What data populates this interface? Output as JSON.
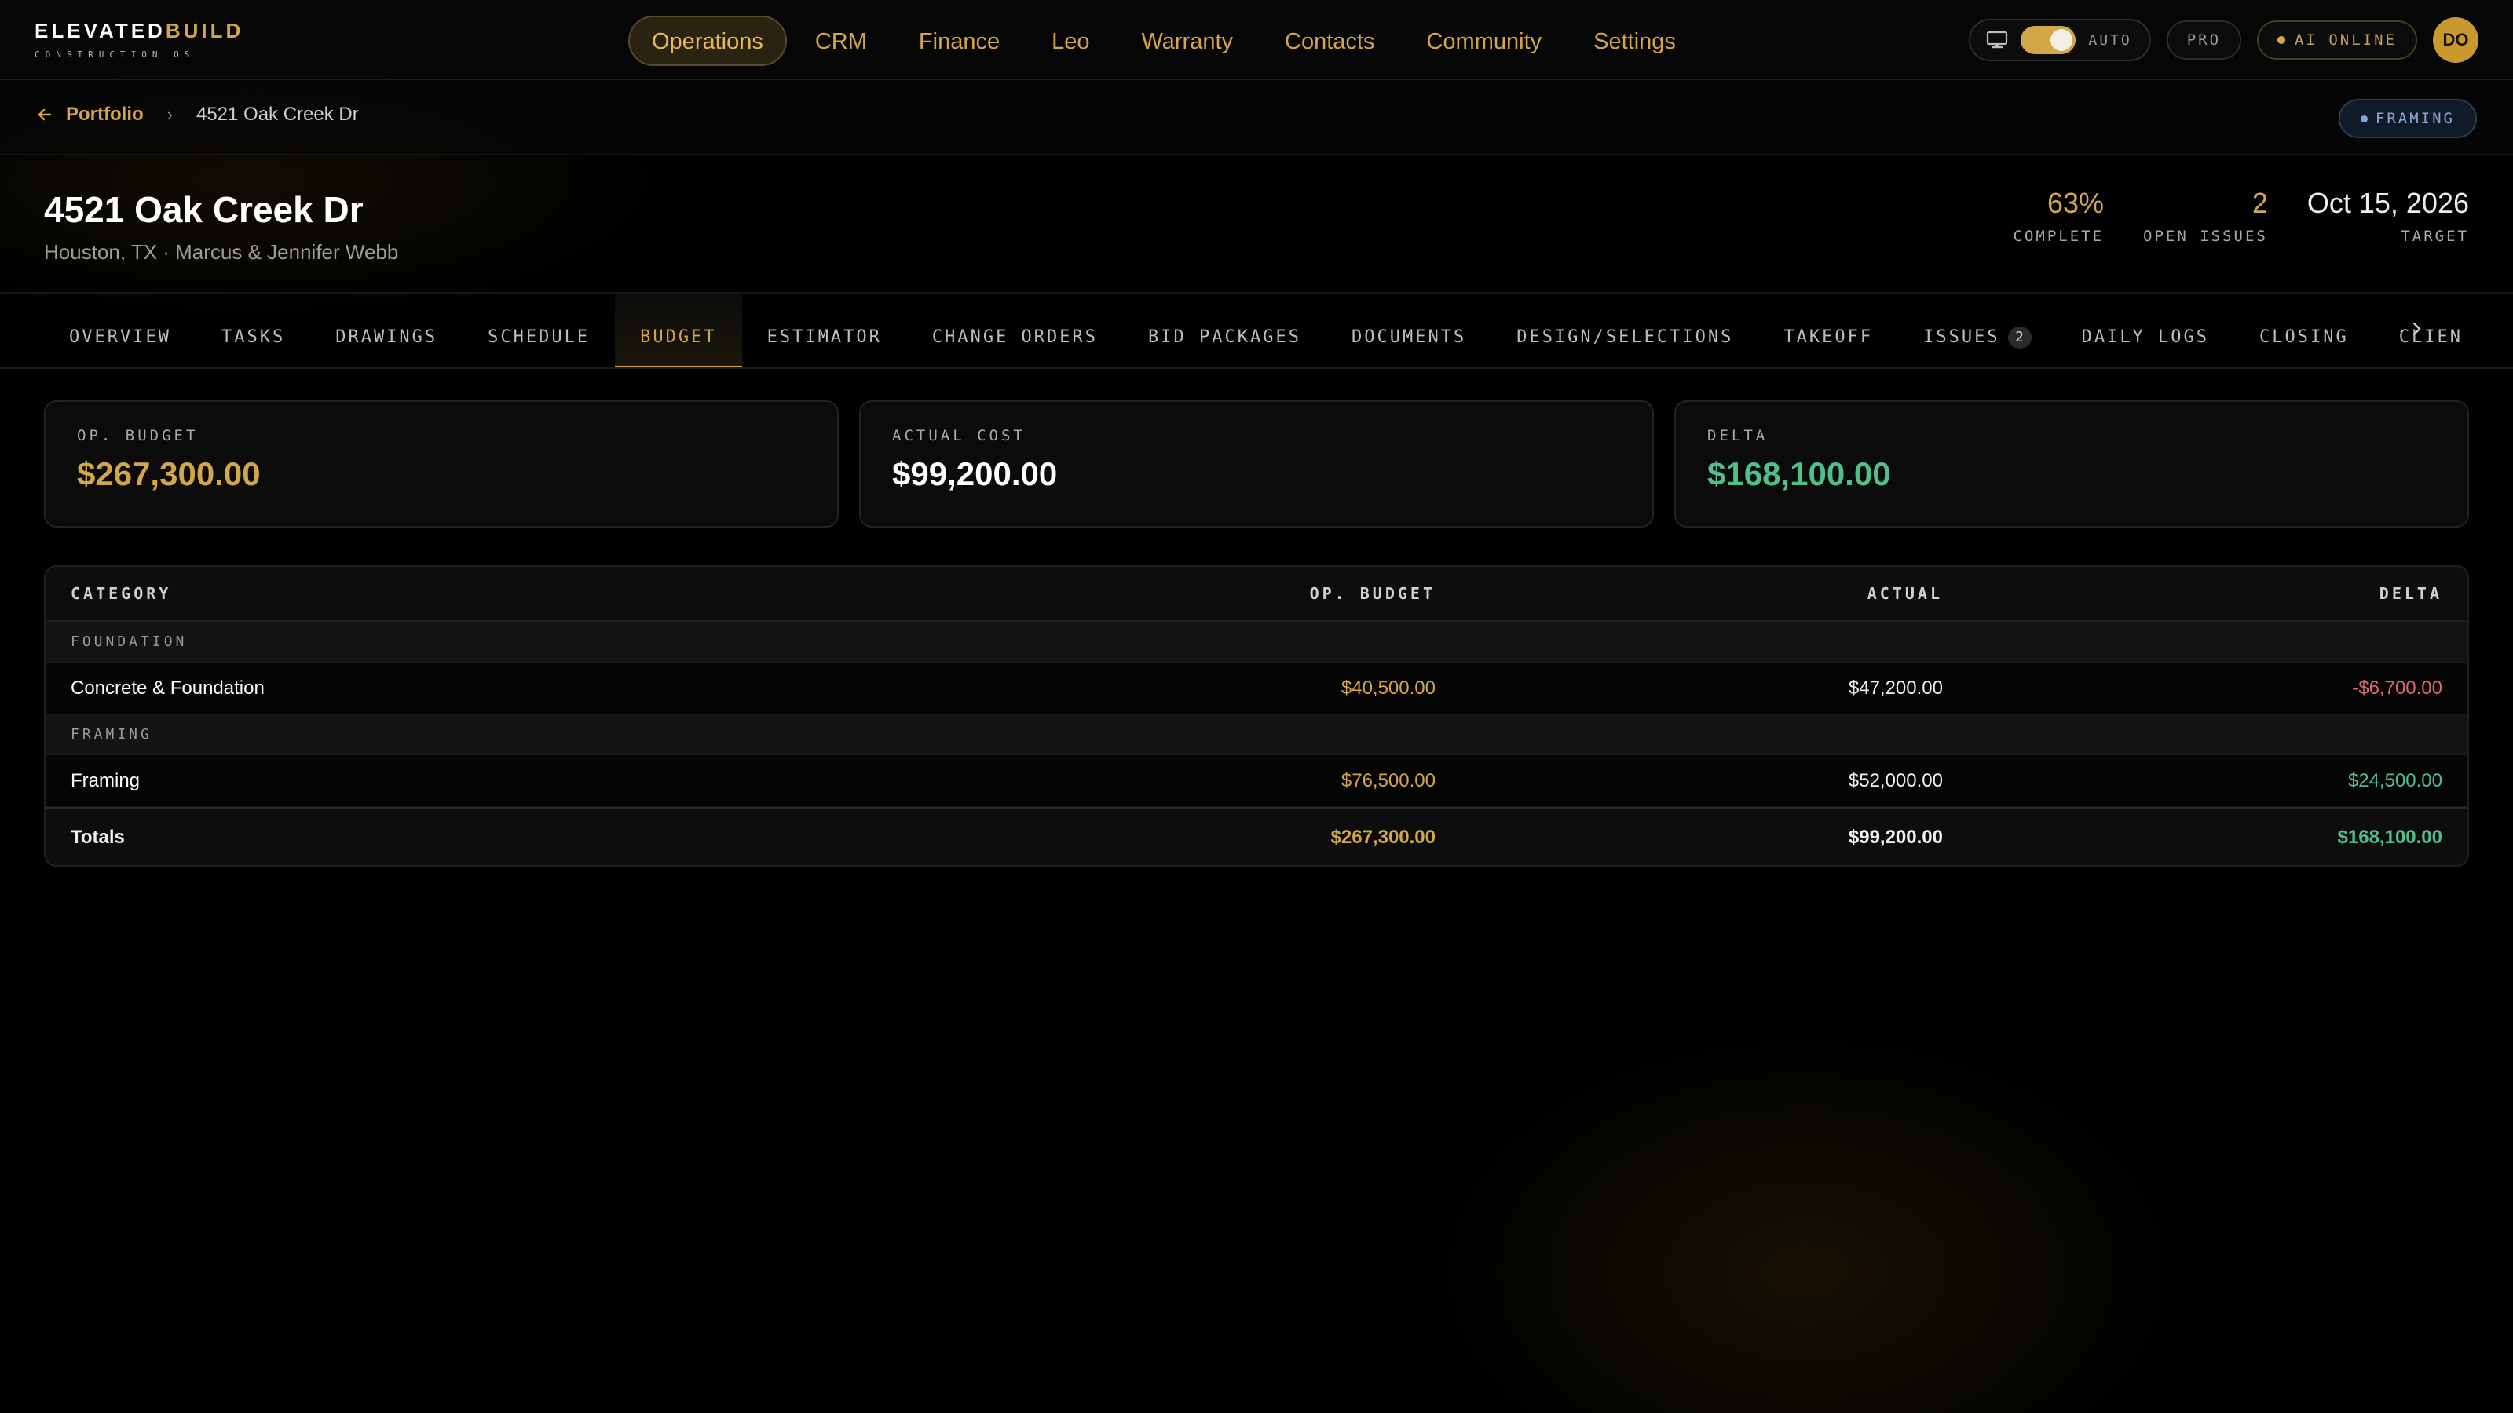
{
  "brand": {
    "name_a": "ELEVATED",
    "name_b": "BUILD",
    "tagline": "CONSTRUCTION OS",
    "accent_color": "#d4a64a"
  },
  "nav": {
    "items": [
      "Operations",
      "CRM",
      "Finance",
      "Leo",
      "Warranty",
      "Contacts",
      "Community",
      "Settings"
    ],
    "active": "Operations"
  },
  "controls": {
    "theme_icon": "monitor-icon",
    "mode_label": "AUTO",
    "plan_label": "PRO",
    "ai_status": "AI ONLINE",
    "user_initials": "DO"
  },
  "breadcrumb": {
    "parent": "Portfolio",
    "separator": "›",
    "current": "4521 Oak Creek Dr"
  },
  "phase_badge": "FRAMING",
  "project": {
    "title": "4521 Oak Creek Dr",
    "subtitle": "Houston, TX · Marcus & Jennifer Webb",
    "stats": [
      {
        "value": "63%",
        "label": "COMPLETE"
      },
      {
        "value": "2",
        "label": "OPEN ISSUES"
      },
      {
        "value": "Oct 15, 2026",
        "label": "TARGET"
      }
    ]
  },
  "tabs": [
    {
      "label": "OVERVIEW"
    },
    {
      "label": "TASKS"
    },
    {
      "label": "DRAWINGS"
    },
    {
      "label": "SCHEDULE"
    },
    {
      "label": "BUDGET",
      "active": true
    },
    {
      "label": "ESTIMATOR"
    },
    {
      "label": "CHANGE ORDERS"
    },
    {
      "label": "BID PACKAGES"
    },
    {
      "label": "DOCUMENTS"
    },
    {
      "label": "DESIGN/SELECTIONS"
    },
    {
      "label": "TAKEOFF"
    },
    {
      "label": "ISSUES",
      "badge": "2"
    },
    {
      "label": "DAILY LOGS"
    },
    {
      "label": "CLOSING"
    },
    {
      "label": "CLIEN"
    }
  ],
  "summary": [
    {
      "label": "OP. BUDGET",
      "value": "$267,300.00",
      "tone": "gold"
    },
    {
      "label": "ACTUAL COST",
      "value": "$99,200.00",
      "tone": "white"
    },
    {
      "label": "DELTA",
      "value": "$168,100.00",
      "tone": "green"
    }
  ],
  "table": {
    "headers": {
      "category": "CATEGORY",
      "budget": "OP. BUDGET",
      "actual": "ACTUAL",
      "delta": "DELTA"
    },
    "groups": [
      {
        "name": "FOUNDATION",
        "rows": [
          {
            "category": "Concrete & Foundation",
            "budget": "$40,500.00",
            "actual": "$47,200.00",
            "delta": "-$6,700.00",
            "delta_tone": "red"
          }
        ]
      },
      {
        "name": "FRAMING",
        "rows": [
          {
            "category": "Framing",
            "budget": "$76,500.00",
            "actual": "$52,000.00",
            "delta": "$24,500.00",
            "delta_tone": "green"
          }
        ]
      }
    ],
    "totals": {
      "label": "Totals",
      "budget": "$267,300.00",
      "actual": "$99,200.00",
      "delta": "$168,100.00"
    }
  }
}
